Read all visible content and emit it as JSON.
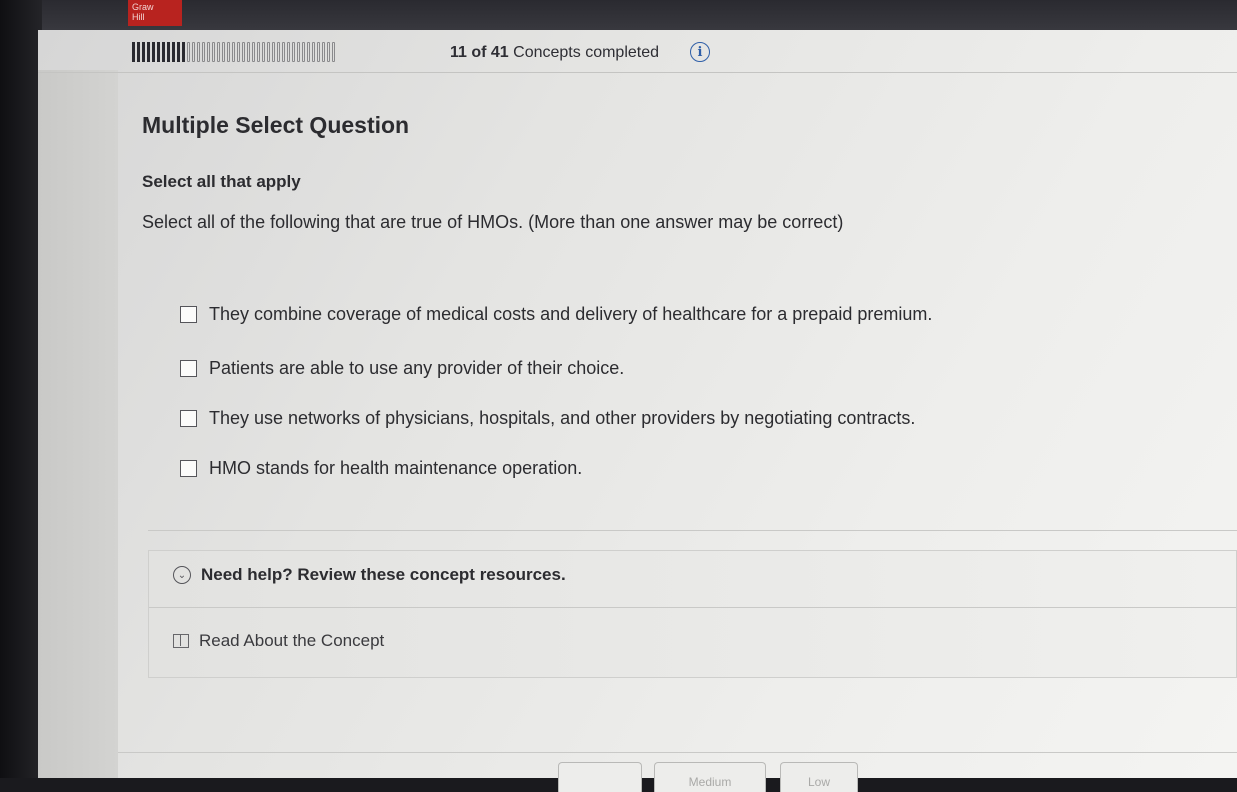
{
  "brand": {
    "logo_text": "Graw\nHill",
    "brand_color": "#b8231f"
  },
  "progress": {
    "completed": 11,
    "total": 41,
    "count_text": "11 of 41",
    "suffix": "Concepts completed",
    "info_icon": "info-icon"
  },
  "question": {
    "type_label": "Multiple Select Question",
    "instruction": "Select all that apply",
    "prompt": "Select all of the following that are true of HMOs. (More than one answer may be correct)",
    "options": [
      {
        "label": "They combine coverage of medical costs and delivery of healthcare for a prepaid premium.",
        "checked": false
      },
      {
        "label": "Patients are able to use any provider of their choice.",
        "checked": false
      },
      {
        "label": "They use networks of physicians, hospitals, and other providers by negotiating contracts.",
        "checked": false
      },
      {
        "label": "HMO stands for health maintenance operation.",
        "checked": false
      }
    ]
  },
  "help": {
    "title": "Need help? Review these concept resources.",
    "expand_icon": "chevron-down-icon",
    "read_label": "Read About the Concept",
    "read_icon": "book-icon"
  },
  "confidence": {
    "buttons": [
      "",
      "Medium",
      "Low"
    ]
  }
}
